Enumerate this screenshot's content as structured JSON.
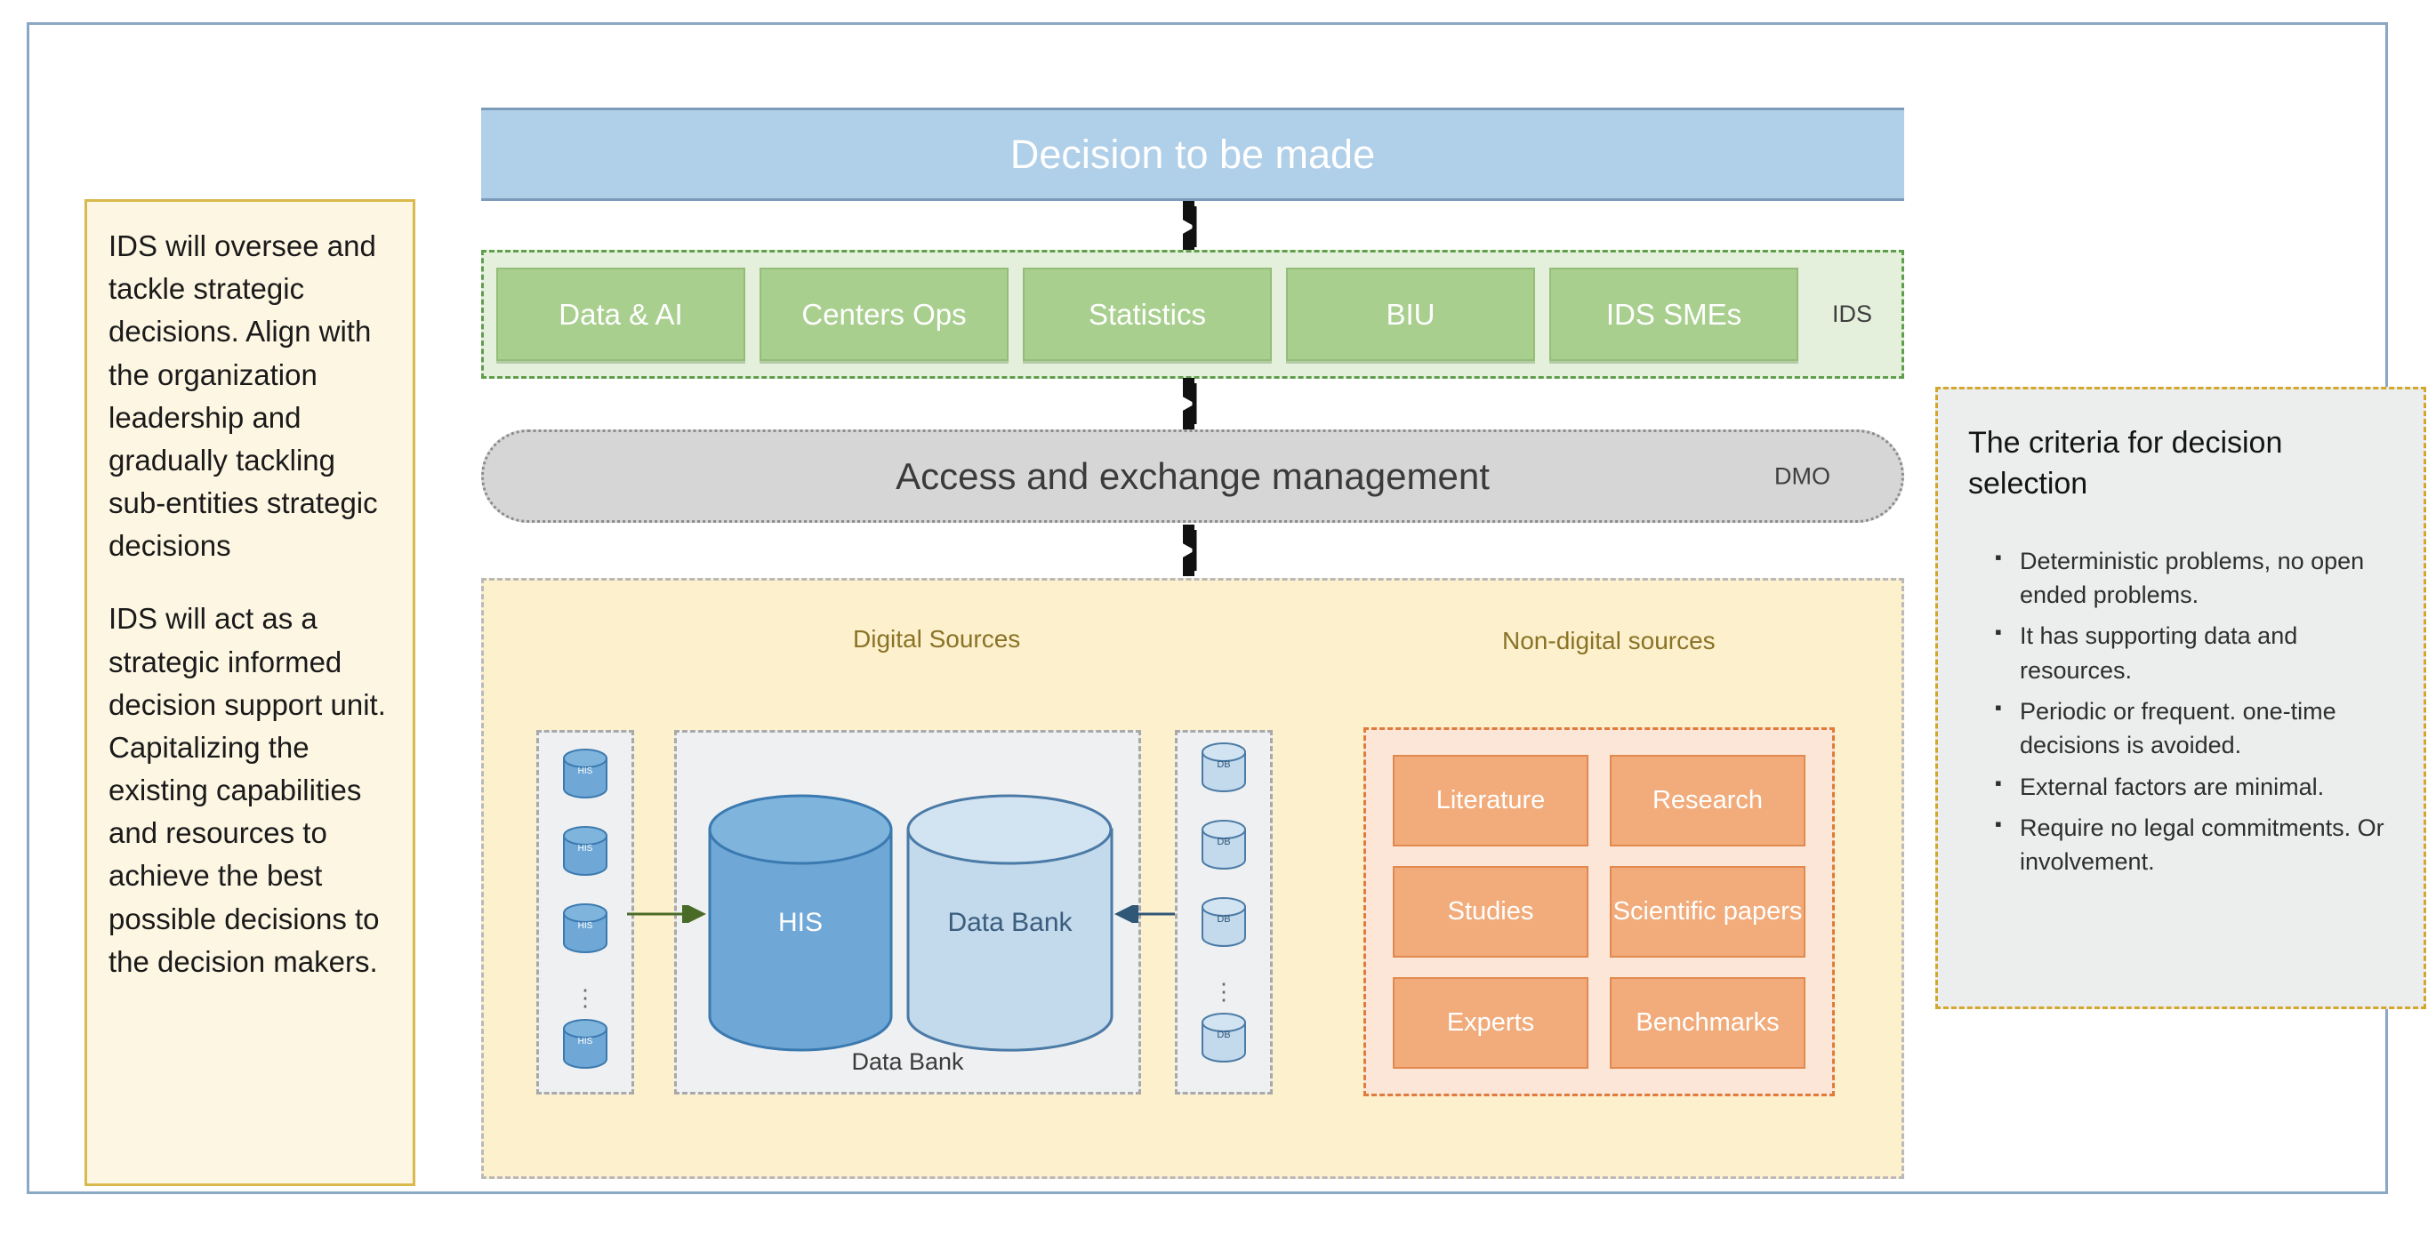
{
  "left_note": {
    "paragraph_1": "IDS will oversee and tackle strategic decisions. Align with the organization leadership and gradually tackling sub-entities strategic decisions",
    "paragraph_2": "IDS will act as a strategic informed decision support unit. Capitalizing the existing capabilities and resources to achieve the best possible decisions to the decision makers."
  },
  "decision_banner": {
    "title": "Decision to be made"
  },
  "ids_band": {
    "label": "IDS",
    "chips": [
      {
        "label": "Data & AI"
      },
      {
        "label": "Centers Ops"
      },
      {
        "label": "Statistics"
      },
      {
        "label": "BIU"
      },
      {
        "label": "IDS SMEs"
      }
    ]
  },
  "dmo_bar": {
    "title": "Access and exchange management",
    "label": "DMO"
  },
  "sources": {
    "digital_heading": "Digital Sources",
    "nondigital_heading": "Non-digital sources",
    "databank_group_label": "Data Bank",
    "left_cylinders": [
      {
        "label": "HIS"
      },
      {
        "label": "HIS"
      },
      {
        "label": "HIS"
      },
      {
        "label": "HIS"
      }
    ],
    "left_ellipsis": "⋮",
    "right_cylinders": [
      {
        "label": "DB"
      },
      {
        "label": "DB"
      },
      {
        "label": "DB"
      },
      {
        "label": "DB"
      }
    ],
    "right_ellipsis": "⋮",
    "big_cylinders": [
      {
        "label": "HIS"
      },
      {
        "label": "Data Bank"
      }
    ],
    "nondigital_tiles": [
      {
        "label": "Literature"
      },
      {
        "label": "Research"
      },
      {
        "label": "Studies"
      },
      {
        "label": "Scientific papers"
      },
      {
        "label": "Experts"
      },
      {
        "label": "Benchmarks"
      }
    ]
  },
  "criteria": {
    "title": "The criteria for decision selection",
    "items": [
      {
        "text": "Deterministic problems, no open ended problems."
      },
      {
        "text": "It has supporting data and resources."
      },
      {
        "text": "Periodic or frequent. one-time decisions is avoided."
      },
      {
        "text": "External factors are minimal."
      },
      {
        "text": "Require no legal commitments. Or involvement."
      }
    ]
  },
  "colors": {
    "frame_border": "#8aa7c4",
    "banner_blue": "#b0cfe8",
    "ids_chip_green": "#a9cf8f",
    "ids_band_green": "#e4f0dc",
    "dmo_grey": "#d6d6d6",
    "sources_yellow": "#fdf0cd",
    "nondigital_tile_orange": "#f2ac7b",
    "note_yellow": "#fdf6e3",
    "criteria_grey": "#eceded",
    "cylinder_his_blue": "#6fa8d6",
    "cylinder_bank_blue": "#c3d9ec"
  }
}
